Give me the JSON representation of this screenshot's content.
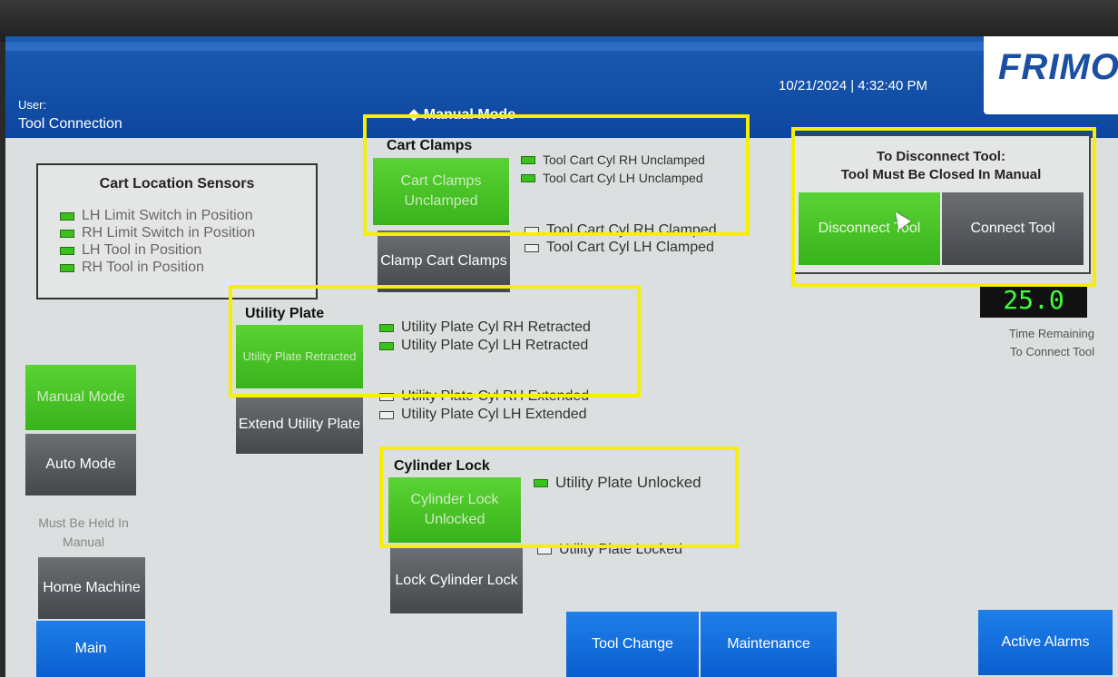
{
  "header": {
    "user_label": "User:",
    "screen_name": "Tool Connection",
    "mode": "◆ Manual Mode",
    "datetime": "10/21/2024 | 4:32:40 PM",
    "logo": "FRIMO"
  },
  "cart_location": {
    "title": "Cart Location Sensors",
    "items": [
      {
        "label": "LH Limit Switch in Position",
        "on": true
      },
      {
        "label": "RH Limit Switch in Position",
        "on": true
      },
      {
        "label": "LH Tool in Position",
        "on": true
      },
      {
        "label": "RH Tool in Position",
        "on": true
      }
    ]
  },
  "cart_clamps": {
    "title": "Cart Clamps",
    "status_button": "Cart Clamps Unclamped",
    "action_button": "Clamp Cart Clamps",
    "indicators": [
      {
        "label": "Tool Cart Cyl RH Unclamped",
        "on": true
      },
      {
        "label": "Tool Cart Cyl LH Unclamped",
        "on": true
      },
      {
        "label": "Tool Cart Cyl RH Clamped",
        "on": false
      },
      {
        "label": "Tool Cart Cyl LH Clamped",
        "on": false
      }
    ]
  },
  "utility_plate": {
    "title": "Utility Plate",
    "status_button": "Utility Plate Retracted",
    "action_button": "Extend Utility Plate",
    "indicators": [
      {
        "label": "Utility Plate Cyl RH Retracted",
        "on": true
      },
      {
        "label": "Utility Plate Cyl LH Retracted",
        "on": true
      },
      {
        "label": "Utility Plate Cyl RH Extended",
        "on": false
      },
      {
        "label": "Utility Plate Cyl LH Extended",
        "on": false
      }
    ]
  },
  "cylinder_lock": {
    "title": "Cylinder Lock",
    "status_button": "Cylinder Lock Unlocked",
    "action_button": "Lock Cylinder Lock",
    "indicators": [
      {
        "label": "Utility Plate Unlocked",
        "on": true
      },
      {
        "label": "Utility Plate Locked",
        "on": false
      }
    ]
  },
  "disconnect": {
    "title_line1": "To Disconnect Tool:",
    "title_line2": "Tool Must Be Closed In Manual",
    "disconnect_button": "Disconnect Tool",
    "connect_button": "Connect Tool",
    "time_value": "25.0",
    "time_label_line1": "Time Remaining",
    "time_label_line2": "To Connect Tool"
  },
  "mode_buttons": {
    "manual": "Manual Mode",
    "auto": "Auto Mode",
    "note": "Must Be Held In Manual",
    "home": "Home Machine"
  },
  "nav": {
    "main": "Main",
    "tool_change": "Tool Change",
    "maintenance": "Maintenance",
    "active_alarms": "Active Alarms"
  },
  "colors": {
    "header_blue": "#0d46a0",
    "active_green": "#39c21a",
    "button_gray": "#55585c",
    "nav_blue": "#0a6ee0",
    "highlight_yellow": "#f5f000"
  }
}
